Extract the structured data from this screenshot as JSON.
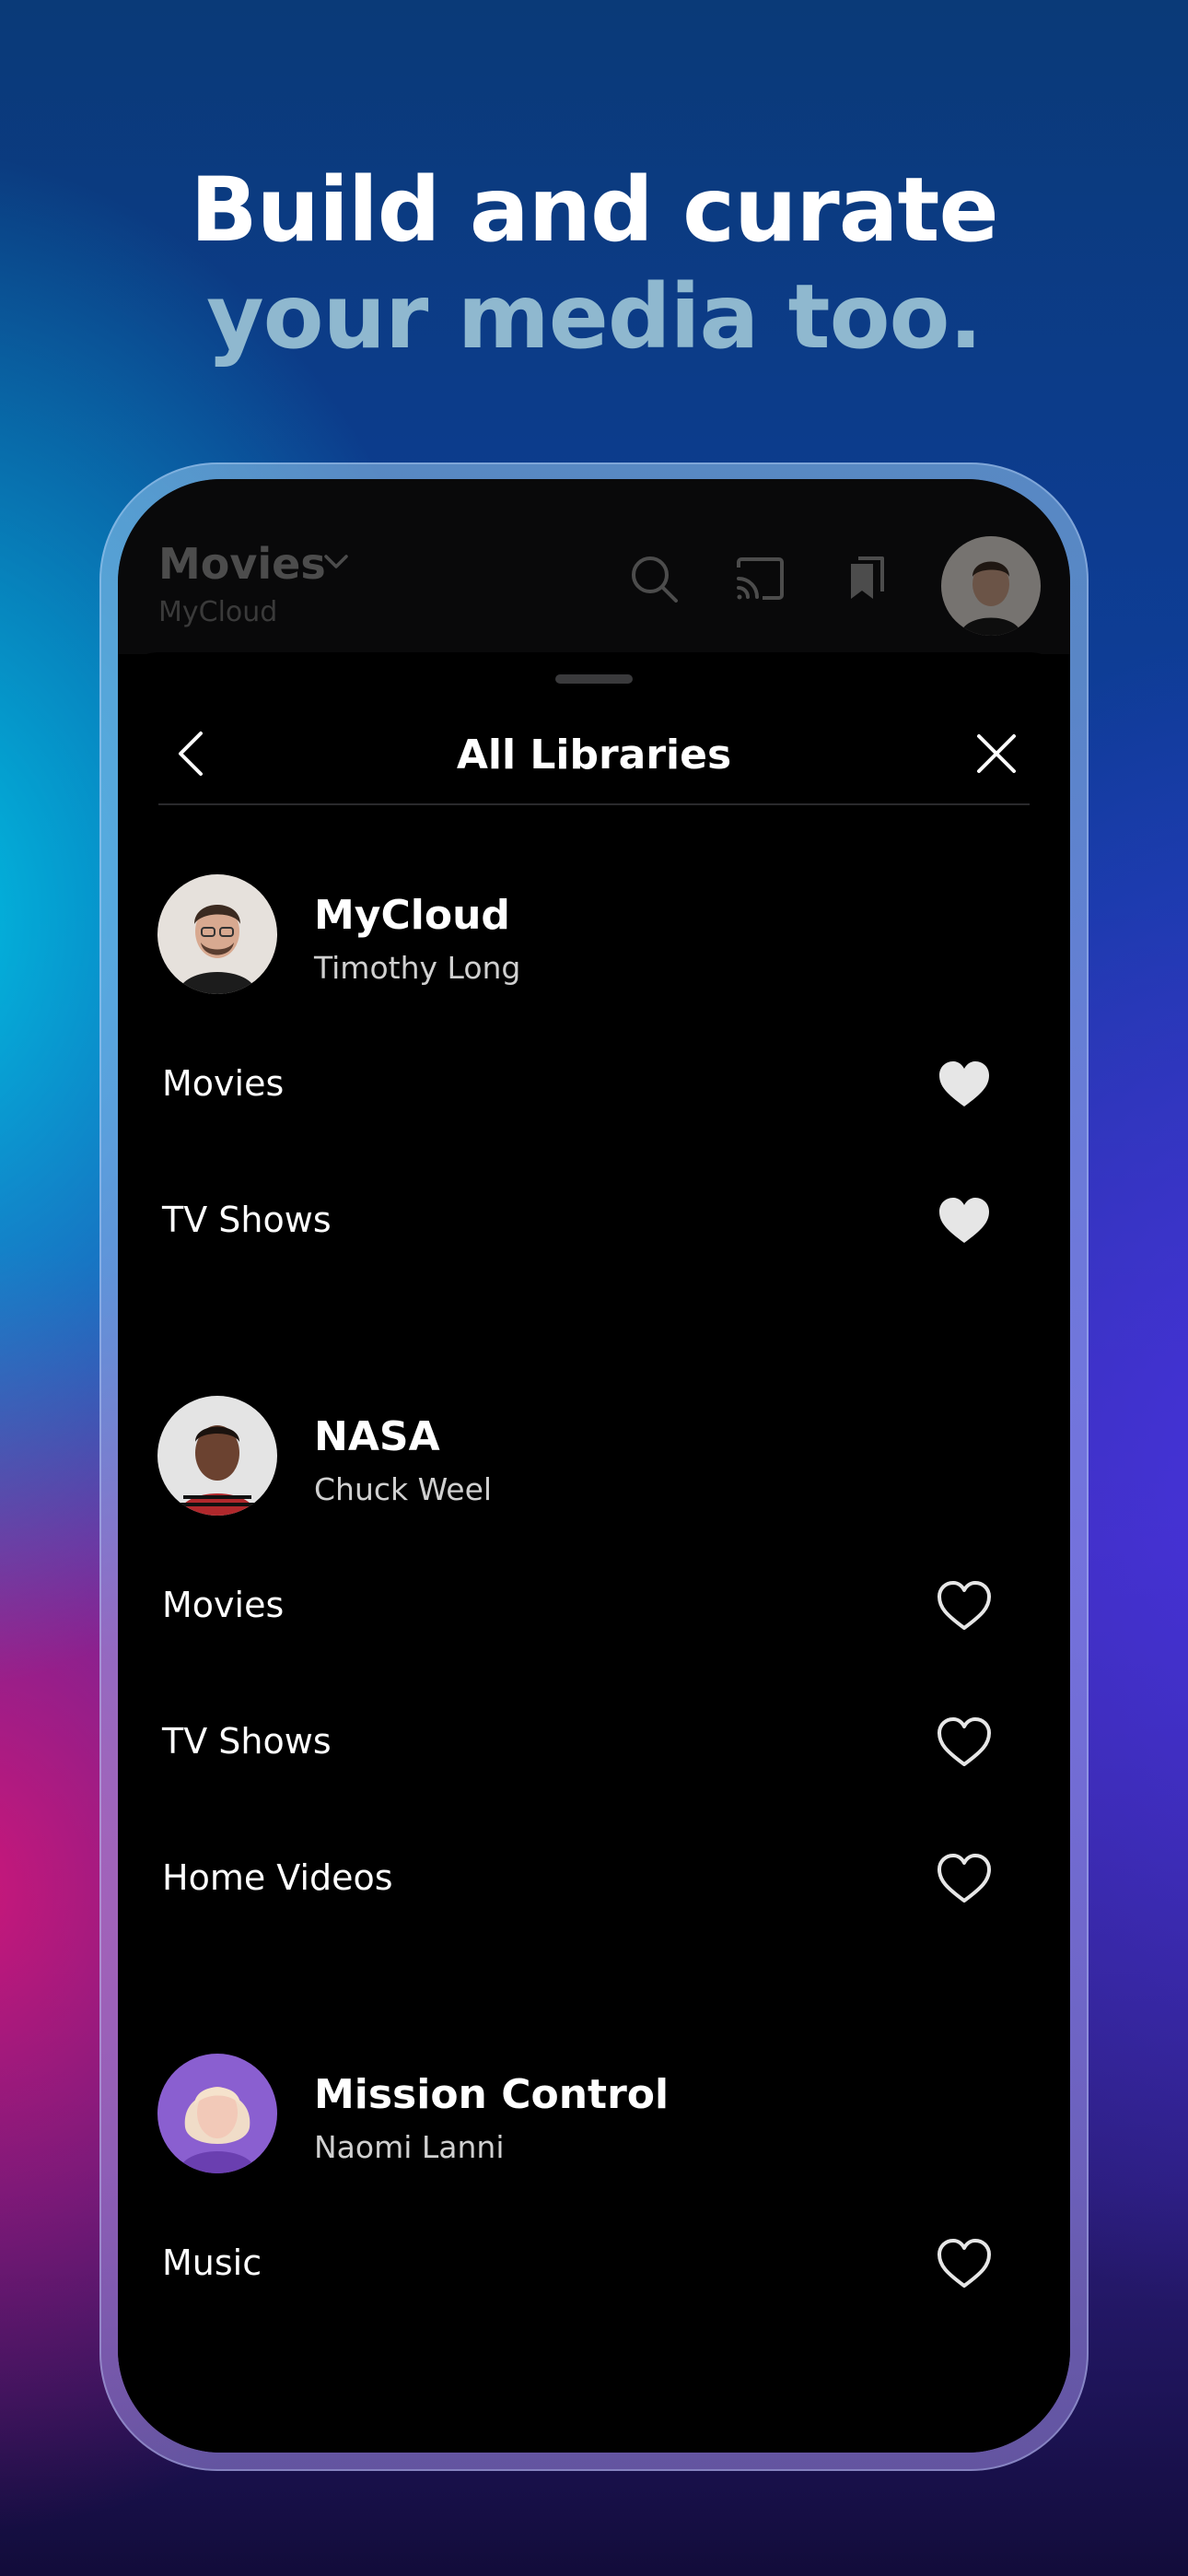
{
  "headline": {
    "line1": "Build and curate",
    "line2": "your media too."
  },
  "app_bar": {
    "title": "Movies",
    "subtitle": "MyCloud",
    "icons": [
      "search-icon",
      "cast-icon",
      "bookmarks-icon"
    ]
  },
  "sheet": {
    "title": "All Libraries",
    "back_icon": "chevron-left-icon",
    "close_icon": "close-icon"
  },
  "servers": [
    {
      "name": "MyCloud",
      "owner": "Timothy Long",
      "libraries": [
        {
          "label": "Movies",
          "favorite": true
        },
        {
          "label": "TV Shows",
          "favorite": true
        }
      ]
    },
    {
      "name": "NASA",
      "owner": "Chuck Weel",
      "libraries": [
        {
          "label": "Movies",
          "favorite": false
        },
        {
          "label": "TV Shows",
          "favorite": false
        },
        {
          "label": "Home Videos",
          "favorite": false
        }
      ]
    },
    {
      "name": "Mission Control",
      "owner": "Naomi Lanni",
      "libraries": [
        {
          "label": "Music",
          "favorite": false
        }
      ]
    }
  ],
  "colors": {
    "headline_primary": "#ffffff",
    "headline_secondary": "#8fb8cf",
    "sheet_background": "#000000",
    "favorite_fill": "#e6e6e6"
  }
}
